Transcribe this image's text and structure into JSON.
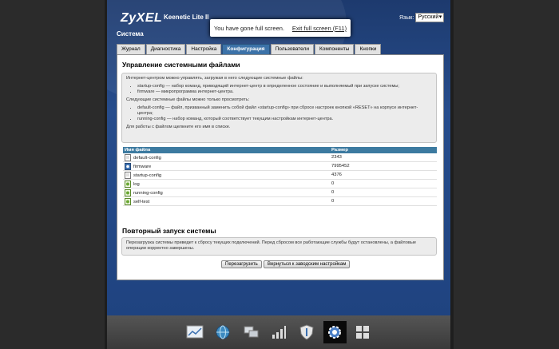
{
  "header": {
    "logo": "ZyXEL",
    "model": "Keenetic Lite II",
    "section": "Система",
    "lang_label": "Язык:",
    "lang_value": "Русский"
  },
  "toast": {
    "message": "You have gone full screen.",
    "exit_link": "Exit full screen (F11)"
  },
  "tabs": [
    "Журнал",
    "Диагностика",
    "Настройка",
    "Конфигурация",
    "Пользователи",
    "Компоненты",
    "Кнопки"
  ],
  "active_tab": "Конфигурация",
  "files_section": {
    "title": "Управление системными файлами",
    "intro": "Интернет-центром можно управлять, загружая в него следующие системные файлы:",
    "bullets1": [
      "startup-config — набор команд, приводящий интернет-центр в определенное состояние и выполняемый при запуске системы;",
      "firmware — микропрограмма интернет-центра."
    ],
    "intro2": "Следующие системные файлы можно только просмотреть:",
    "bullets2": [
      "default-config — файл, призванный заменить собой файл «startup-config» при сбросе настроек кнопкой «RESET» на корпусе интернет-центра;",
      "running-config — набор команд, который соответствует текущим настройкам интернет-центра."
    ],
    "footer": "Для работы с файлом щелкните его имя в списке.",
    "columns": [
      "Имя файла",
      "Размер"
    ],
    "rows": [
      {
        "name": "default-config",
        "size": "2343",
        "icon": "file-icon"
      },
      {
        "name": "firmware",
        "size": "7995452",
        "icon": "gear-icon"
      },
      {
        "name": "startup-config",
        "size": "4376",
        "icon": "file-icon"
      },
      {
        "name": "log",
        "size": "0",
        "icon": "log-icon"
      },
      {
        "name": "running-config",
        "size": "0",
        "icon": "log-icon"
      },
      {
        "name": "self-test",
        "size": "0",
        "icon": "log-icon"
      }
    ]
  },
  "reboot_section": {
    "title": "Повторный запуск системы",
    "text": "Перезагрузка системы приведет к сбросу текущих подключений. Перед сбросом все работающие службы будут остановлены, а файловые операции корректно завершены.",
    "reboot_button": "Перезагрузить",
    "reset_button": "Вернуться к заводским настройкам"
  },
  "dock": [
    "chart-icon",
    "globe-icon",
    "network-icon",
    "signal-icon",
    "shield-icon",
    "gear-icon",
    "apps-icon"
  ],
  "dock_active": "gear-icon"
}
